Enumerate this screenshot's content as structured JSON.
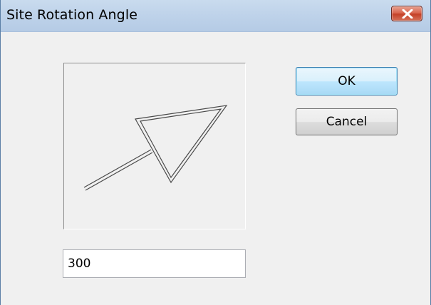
{
  "window": {
    "title": "Site Rotation Angle"
  },
  "preview": {
    "icon": "rotation-arrow-icon"
  },
  "buttons": {
    "ok_label": "OK",
    "cancel_label": "Cancel"
  },
  "angle_field": {
    "value": "300"
  },
  "colors": {
    "dialog_bg": "#f0f0f0",
    "titlebar_bg": "#bfd3ea",
    "close_button": "#c44128",
    "ok_button_border": "#3c7fb1"
  }
}
